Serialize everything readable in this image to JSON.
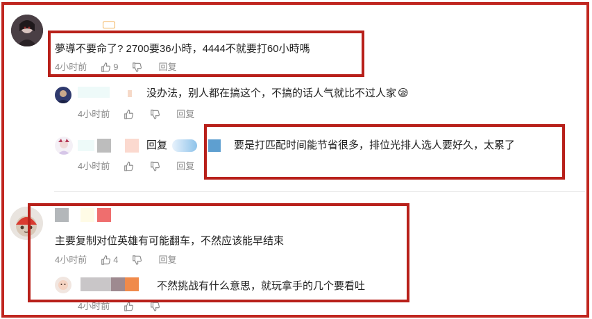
{
  "comments": [
    {
      "text": "夢導不要命了? 2700要36小時，4444不就要打60小時嗎",
      "time": "4小时前",
      "likes": "9",
      "reply_label": "回复",
      "replies": [
        {
          "text": "没办法，别人都在搞这个，不搞的话人气就比不过人家",
          "emoji": "😪",
          "time": "4小时前",
          "reply_label": "回复"
        },
        {
          "prefix": "回复",
          "text": "要是打匹配时间能节省很多，排位光排人选人要好久，太累了",
          "time": "4小时前",
          "reply_label": "回复"
        }
      ]
    },
    {
      "text": "主要复制对位英雄有可能翻车，不然应该能早结束",
      "time": "4小时前",
      "likes": "4",
      "reply_label": "回复",
      "replies": [
        {
          "text": "不然挑战有什么意思，就玩拿手的几个要看吐",
          "time": "4小时前"
        }
      ]
    }
  ],
  "colors": {
    "highlight": "#b8201a",
    "meta_text": "#8a8a8a",
    "body_text": "#222222"
  }
}
